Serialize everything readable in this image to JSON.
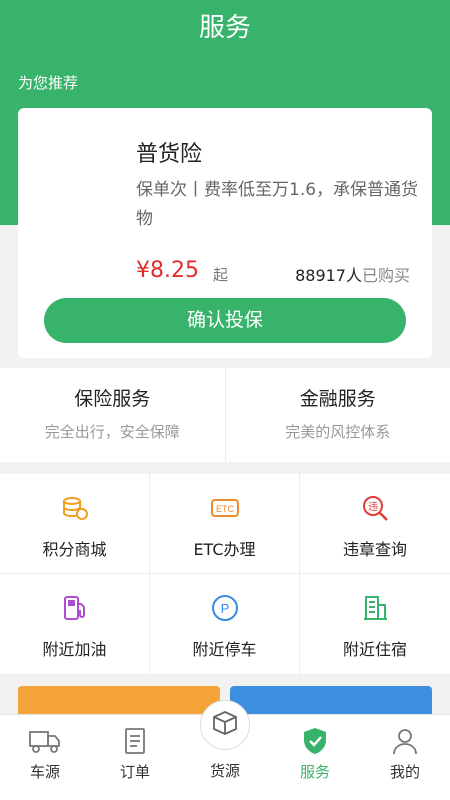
{
  "header": {
    "title": "服务"
  },
  "recommend": {
    "label": "为您推荐",
    "card": {
      "title": "普货险",
      "desc": "保单次丨费率低至万1.6，承保普通货物",
      "price": "¥8.25",
      "price_suffix": "起",
      "buyers": "88917人",
      "buyers_suffix": "已购买",
      "button": "确认投保"
    }
  },
  "services": [
    {
      "title": "保险服务",
      "subtitle": "完全出行，安全保障"
    },
    {
      "title": "金融服务",
      "subtitle": "完美的风控体系"
    }
  ],
  "grid": [
    {
      "label": "积分商城",
      "icon": "coins-icon"
    },
    {
      "label": "ETC办理",
      "icon": "etc-icon"
    },
    {
      "label": "违章查询",
      "icon": "violation-search-icon"
    },
    {
      "label": "附近加油",
      "icon": "fuel-pump-icon"
    },
    {
      "label": "附近停车",
      "icon": "parking-icon"
    },
    {
      "label": "附近住宿",
      "icon": "building-icon"
    }
  ],
  "tabbar": {
    "items": [
      {
        "label": "车源",
        "icon": "truck-icon"
      },
      {
        "label": "订单",
        "icon": "document-icon"
      },
      {
        "label": "货源",
        "icon": "box-icon"
      },
      {
        "label": "服务",
        "icon": "shield-check-icon",
        "active": true
      },
      {
        "label": "我的",
        "icon": "user-icon"
      }
    ]
  },
  "colors": {
    "primary": "#37b36b",
    "price": "#e02d2d",
    "orange": "#f5a43a",
    "blue": "#3f8fe0"
  }
}
